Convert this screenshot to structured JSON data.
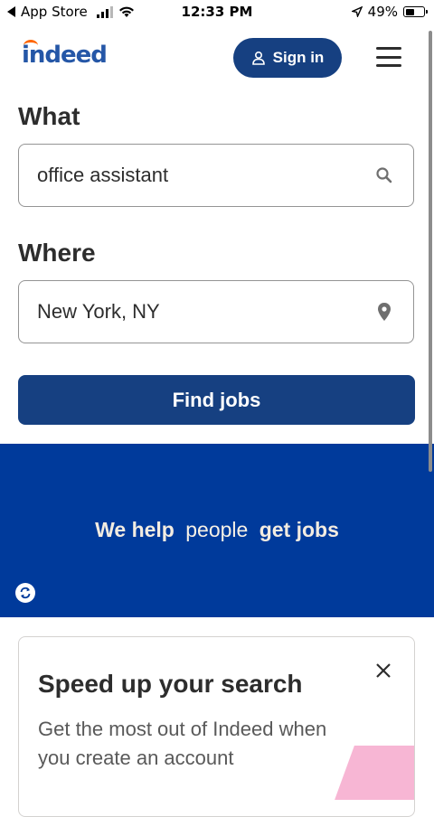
{
  "status_bar": {
    "back_label": "App Store",
    "time": "12:33 PM",
    "battery": "49%",
    "battery_level": 0.49
  },
  "header": {
    "logo": "indeed",
    "sign_in_label": "Sign in"
  },
  "search": {
    "what_label": "What",
    "what_value": "office assistant",
    "where_label": "Where",
    "where_value": "New York, NY",
    "button_label": "Find jobs"
  },
  "banner": {
    "part1": "We help",
    "part2": "people",
    "part3": "get jobs"
  },
  "promo_card": {
    "title": "Speed up your search",
    "body": "Get the most out of Indeed when you create an account"
  },
  "colors": {
    "primary": "#164081",
    "banner": "#003a9b",
    "text": "#2d2d2d"
  }
}
